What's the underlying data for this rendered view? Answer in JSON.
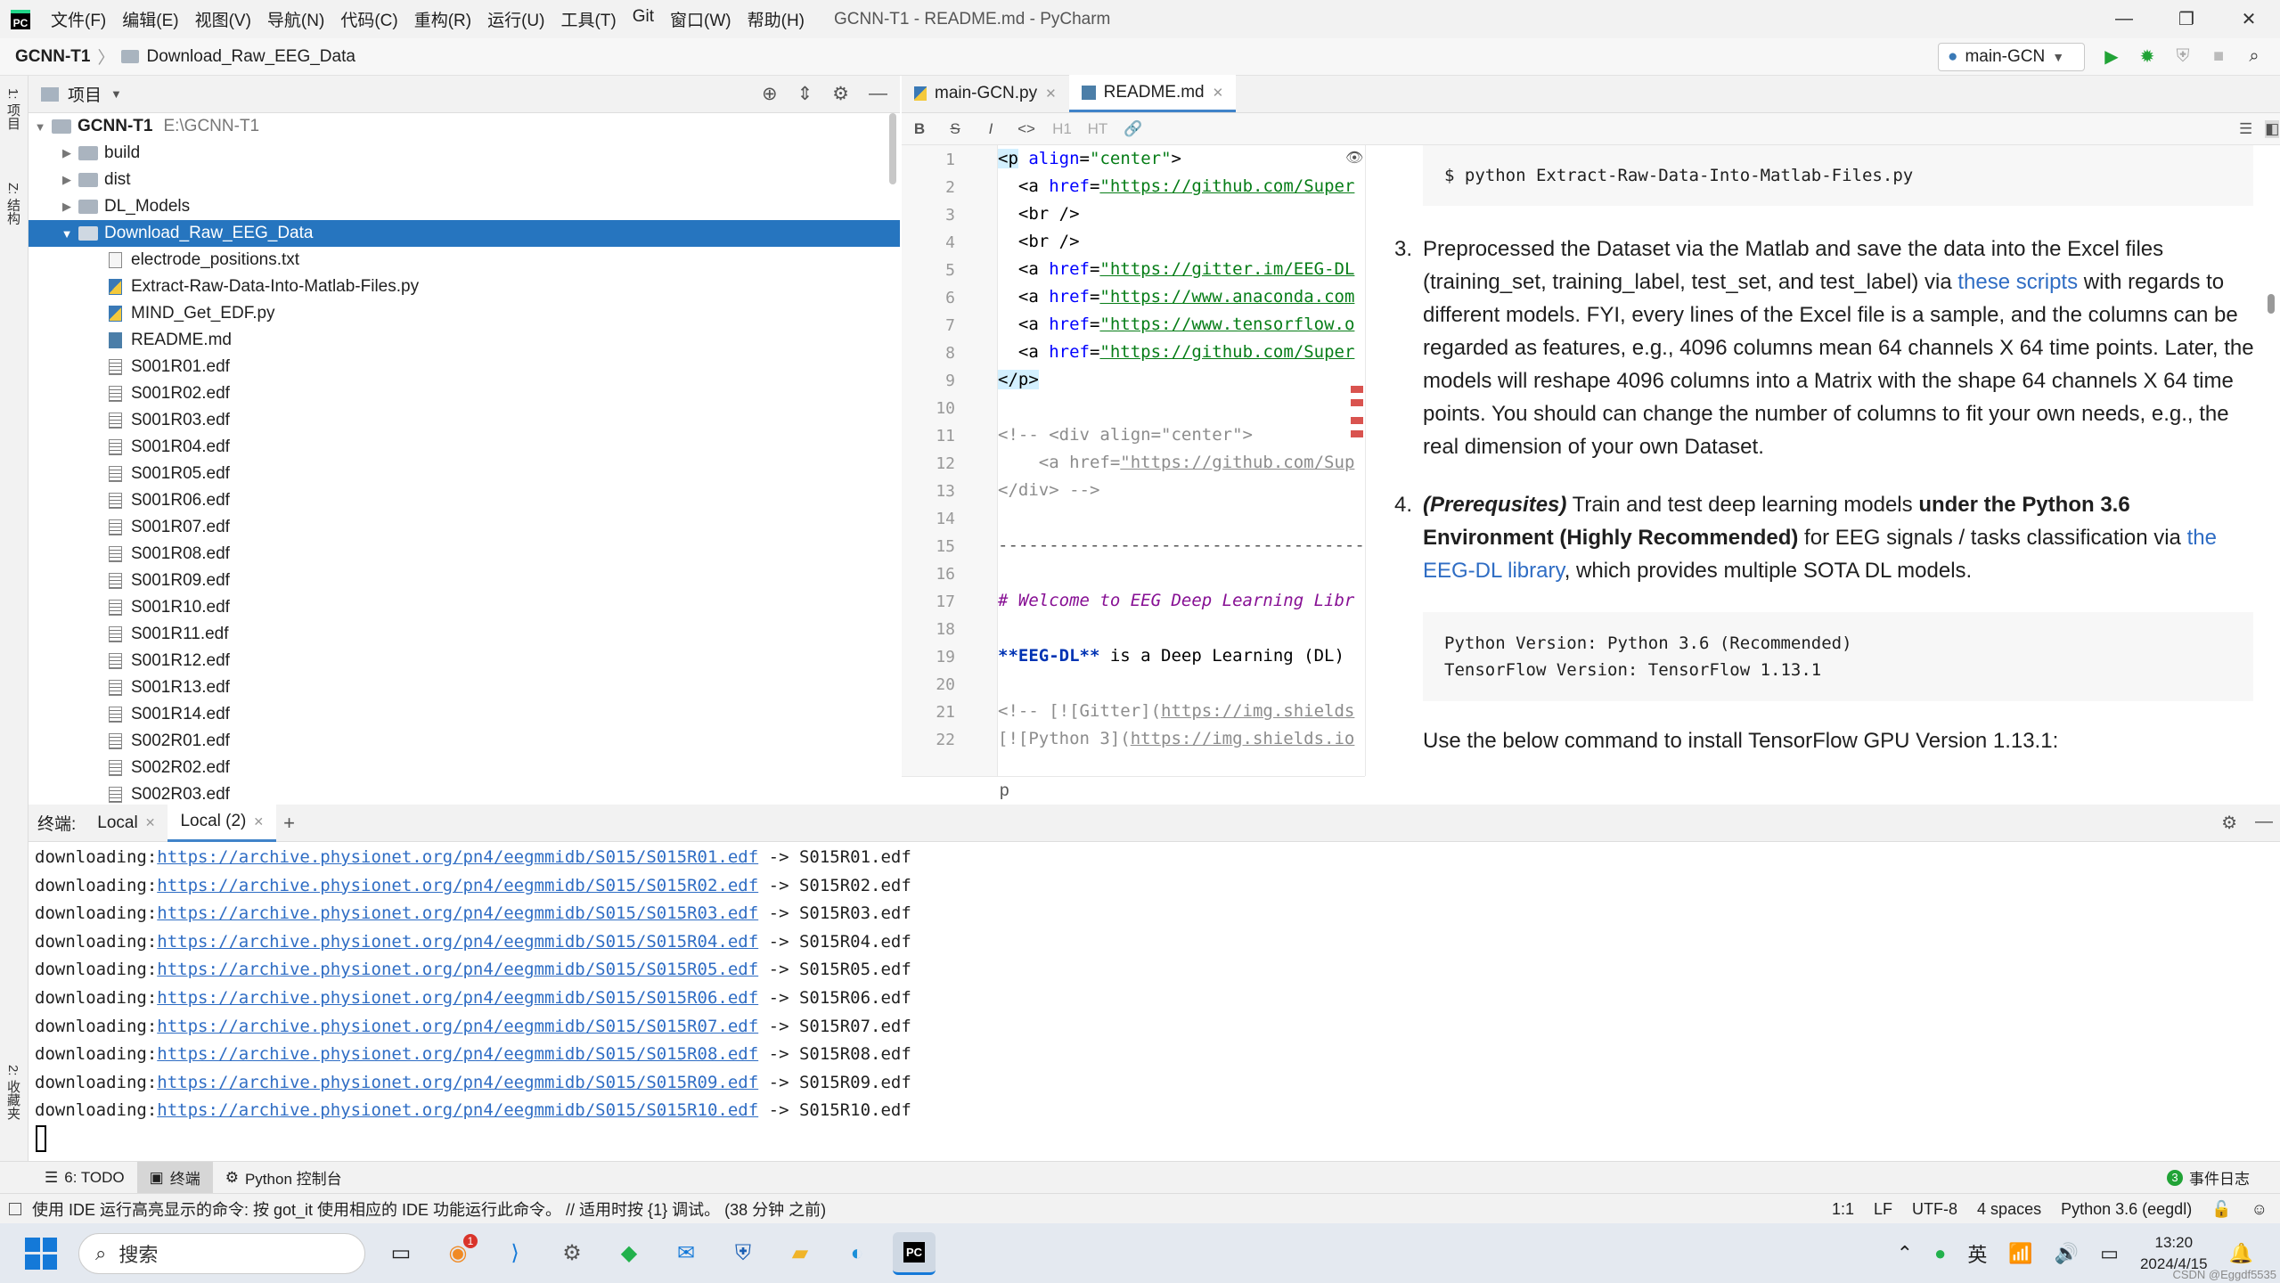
{
  "window": {
    "menus": [
      "文件(F)",
      "编辑(E)",
      "视图(V)",
      "导航(N)",
      "代码(C)",
      "重构(R)",
      "运行(U)",
      "工具(T)",
      "Git",
      "窗口(W)",
      "帮助(H)"
    ],
    "title": "GCNN-T1 - README.md - PyCharm",
    "controls": [
      "—",
      "❐",
      "✕"
    ]
  },
  "navbar": {
    "project": "GCNN-T1",
    "folder": "Download_Raw_EEG_Data",
    "run_config": "main-GCN"
  },
  "left_strip": {
    "project_tab": "1: 项目",
    "structure_tab": "Z: 结构",
    "favorites_tab": "2: 收藏夹"
  },
  "project_panel": {
    "title": "项目",
    "root_name": "GCNN-T1",
    "root_path": "E:\\GCNN-T1",
    "folders": [
      "build",
      "dist",
      "DL_Models"
    ],
    "selected_folder": "Download_Raw_EEG_Data",
    "files": [
      {
        "name": "electrode_positions.txt",
        "type": "txt"
      },
      {
        "name": "Extract-Raw-Data-Into-Matlab-Files.py",
        "type": "py"
      },
      {
        "name": "MIND_Get_EDF.py",
        "type": "py"
      },
      {
        "name": "README.md",
        "type": "md"
      },
      {
        "name": "S001R01.edf",
        "type": "edf"
      },
      {
        "name": "S001R02.edf",
        "type": "edf"
      },
      {
        "name": "S001R03.edf",
        "type": "edf"
      },
      {
        "name": "S001R04.edf",
        "type": "edf"
      },
      {
        "name": "S001R05.edf",
        "type": "edf"
      },
      {
        "name": "S001R06.edf",
        "type": "edf"
      },
      {
        "name": "S001R07.edf",
        "type": "edf"
      },
      {
        "name": "S001R08.edf",
        "type": "edf"
      },
      {
        "name": "S001R09.edf",
        "type": "edf"
      },
      {
        "name": "S001R10.edf",
        "type": "edf"
      },
      {
        "name": "S001R11.edf",
        "type": "edf"
      },
      {
        "name": "S001R12.edf",
        "type": "edf"
      },
      {
        "name": "S001R13.edf",
        "type": "edf"
      },
      {
        "name": "S001R14.edf",
        "type": "edf"
      },
      {
        "name": "S002R01.edf",
        "type": "edf"
      },
      {
        "name": "S002R02.edf",
        "type": "edf"
      },
      {
        "name": "S002R03.edf",
        "type": "edf"
      }
    ]
  },
  "editor": {
    "tabs": [
      {
        "label": "main-GCN.py",
        "active": false
      },
      {
        "label": "README.md",
        "active": true
      }
    ],
    "toolbar": [
      "B",
      "S",
      "I",
      "<>",
      "H1",
      "HT",
      "🔗"
    ],
    "line_numbers": [
      "1",
      "2",
      "3",
      "4",
      "5",
      "6",
      "7",
      "8",
      "9",
      "10",
      "11",
      "12",
      "13",
      "14",
      "15",
      "16",
      "17",
      "18",
      "19",
      "20",
      "21",
      "22"
    ],
    "breadcrumb": "p"
  },
  "preview": {
    "code1": "$ python Extract-Raw-Data-Into-Matlab-Files.py",
    "item3_num": "3.",
    "item3_lines": [
      "Preprocessed the Dataset via the Matlab and save the data into the Excel files",
      "(training_set, training_label, test_set, and test_label) via ",
      "different models. FYI, every lines of the Excel file is a sample, and the columns can be",
      "regarded as features, e.g., 4096 columns mean 64 channels X 64 time points. Later, the",
      "models will reshape 4096 columns into a Matrix with the shape 64 channels X 64 time",
      "points. You should can change the number of columns to fit your own needs, e.g., the",
      "real dimension of your own Dataset."
    ],
    "item3_link": "these scripts",
    "item3_after_link": " with regards to",
    "item4_num": "4.",
    "item4_em": "(Prerequsites)",
    "item4_text1": " Train and test deep learning models ",
    "item4_strong1": "under the Python 3.6",
    "item4_strong2": "Environment (Highly Recommended)",
    "item4_text2": " for EEG signals / tasks classification via ",
    "item4_link1": "the",
    "item4_link2": "EEG-DL library",
    "item4_text3": ", which provides multiple SOTA DL models.",
    "code2_lines": [
      "Python Version: Python 3.6 (Recommended)",
      "TensorFlow Version: TensorFlow 1.13.1"
    ],
    "tail": "Use the below command to install TensorFlow GPU Version 1.13.1:"
  },
  "terminal": {
    "label": "终端:",
    "tabs": [
      {
        "label": "Local",
        "active": false
      },
      {
        "label": "Local (2)",
        "active": true
      }
    ],
    "lines": [
      {
        "prefix": "downloading:",
        "url": "https://archive.physionet.org/pn4/eegmmidb/S015/S015R01.edf",
        "suffix": " -> S015R01.edf"
      },
      {
        "prefix": "downloading:",
        "url": "https://archive.physionet.org/pn4/eegmmidb/S015/S015R02.edf",
        "suffix": " -> S015R02.edf"
      },
      {
        "prefix": "downloading:",
        "url": "https://archive.physionet.org/pn4/eegmmidb/S015/S015R03.edf",
        "suffix": " -> S015R03.edf"
      },
      {
        "prefix": "downloading:",
        "url": "https://archive.physionet.org/pn4/eegmmidb/S015/S015R04.edf",
        "suffix": " -> S015R04.edf"
      },
      {
        "prefix": "downloading:",
        "url": "https://archive.physionet.org/pn4/eegmmidb/S015/S015R05.edf",
        "suffix": " -> S015R05.edf"
      },
      {
        "prefix": "downloading:",
        "url": "https://archive.physionet.org/pn4/eegmmidb/S015/S015R06.edf",
        "suffix": " -> S015R06.edf"
      },
      {
        "prefix": "downloading:",
        "url": "https://archive.physionet.org/pn4/eegmmidb/S015/S015R07.edf",
        "suffix": " -> S015R07.edf"
      },
      {
        "prefix": "downloading:",
        "url": "https://archive.physionet.org/pn4/eegmmidb/S015/S015R08.edf",
        "suffix": " -> S015R08.edf"
      },
      {
        "prefix": "downloading:",
        "url": "https://archive.physionet.org/pn4/eegmmidb/S015/S015R09.edf",
        "suffix": " -> S015R09.edf"
      },
      {
        "prefix": "downloading:",
        "url": "https://archive.physionet.org/pn4/eegmmidb/S015/S015R10.edf",
        "suffix": " -> S015R10.edf"
      }
    ]
  },
  "toolbar": {
    "todo": "6: TODO",
    "terminal": "终端",
    "python_console": "Python 控制台",
    "event_log_count": "3",
    "event_log": "事件日志"
  },
  "statusbar": {
    "message": "使用 IDE 运行高亮显示的命令: 按 got_it 使用相应的 IDE 功能运行此命令。 // 适用时按 {1} 调试。 (38 分钟 之前)",
    "position": "1:1",
    "line_sep": "LF",
    "encoding": "UTF-8",
    "indent": "4 spaces",
    "interpreter": "Python 3.6 (eegdl)"
  },
  "taskbar": {
    "search_placeholder": "搜索",
    "mail_badge": "1",
    "ime": "英",
    "time": "13:20",
    "date": "2024/4/15",
    "watermark": "CSDN @Eggdf5535"
  },
  "colors": {
    "accent": "#2675bf",
    "link": "#2f6dc4",
    "run_green": "#21a336"
  }
}
